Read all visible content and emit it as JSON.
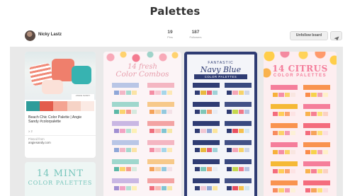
{
  "page": {
    "title": "Palettes"
  },
  "board": {
    "owner": "Nicky Lastz",
    "pins_count": "19",
    "pins_label": "Pins",
    "followers_count": "187",
    "followers_label": "Followers",
    "unfollow_label": "Unfollow board",
    "send_icon": "send-icon"
  },
  "pins": [
    {
      "description": "Beach Chic Color Palette | Angie Sandy #colorpalette",
      "brand": "ANGIE SANDY",
      "repins": "≥ 2",
      "pinned_from_label": "Pinned from",
      "source": "angiesandy.com",
      "swatches": [
        "#2e9c9a",
        "#e35c4c",
        "#f4a492",
        "#f6d3c6",
        "#fbeae4"
      ]
    },
    {
      "title_line1": "14 MINT",
      "title_line2": "COLOR PALETTES"
    },
    {
      "title_line1": "14 fresh",
      "title_line2": "Color Combos"
    },
    {
      "title_pre": "FANTASTIC",
      "title": "Navy Blue",
      "subtitle": "COLOR PALETTES"
    },
    {
      "title": "14 CITRUS",
      "subtitle": "COLOR PALETTES"
    }
  ]
}
